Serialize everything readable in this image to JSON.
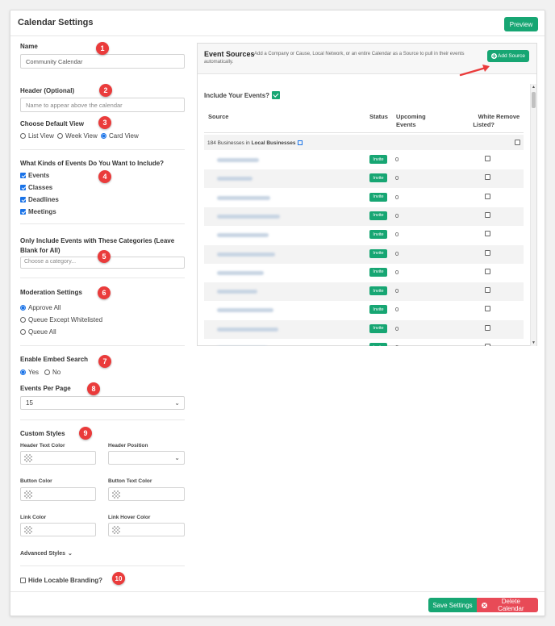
{
  "header": {
    "title": "Calendar Settings",
    "preview_label": "Preview"
  },
  "form": {
    "name": {
      "label": "Name",
      "value": "Community Calendar"
    },
    "header_opt": {
      "label": "Header (Optional)",
      "placeholder": "Name to appear above the calendar"
    },
    "default_view": {
      "label": "Choose Default View",
      "options": [
        "List View",
        "Week View",
        "Card View"
      ],
      "selected": "Card View"
    },
    "kinds": {
      "label": "What Kinds of Events Do You Want to Include?",
      "options": [
        "Events",
        "Classes",
        "Deadlines",
        "Meetings"
      ]
    },
    "categories": {
      "label": "Only Include Events with These Categories (Leave Blank for All)",
      "placeholder": "Choose a category..."
    },
    "moderation": {
      "label": "Moderation Settings",
      "options": [
        "Approve All",
        "Queue Except Whitelisted",
        "Queue All"
      ],
      "selected": "Approve All"
    },
    "embed_search": {
      "label": "Enable Embed Search",
      "options": [
        "Yes",
        "No"
      ],
      "selected": "Yes"
    },
    "per_page": {
      "label": "Events Per Page",
      "value": "15"
    },
    "custom_styles": {
      "label": "Custom Styles",
      "header_text_color": "Header Text Color",
      "header_position": "Header Position",
      "button_color": "Button Color",
      "button_text_color": "Button Text Color",
      "link_color": "Link Color",
      "link_hover_color": "Link Hover Color",
      "advanced": "Advanced Styles"
    },
    "hide_branding": "Hide Locable Branding?"
  },
  "badges": [
    "1",
    "2",
    "3",
    "4",
    "5",
    "6",
    "7",
    "8",
    "9",
    "10"
  ],
  "sources": {
    "title": "Event Sources",
    "description": "Add a Company or Cause, Local Network, or an entire Calendar as a Source to pull in their events automatically.",
    "add_label": "Add Source",
    "include_label": "Include Your Events?",
    "columns": [
      "Source",
      "Status",
      "Upcoming Events",
      "White Listed?",
      "Remove"
    ],
    "group_count": "184 Businesses in",
    "group_name": "Local Businesses",
    "invite_label": "Invite",
    "rows": [
      {
        "upcoming": "0"
      },
      {
        "upcoming": "0"
      },
      {
        "upcoming": "0"
      },
      {
        "upcoming": "0"
      },
      {
        "upcoming": "0"
      },
      {
        "upcoming": "0"
      },
      {
        "upcoming": "0"
      },
      {
        "upcoming": "0"
      },
      {
        "upcoming": "0"
      },
      {
        "upcoming": "0"
      },
      {
        "upcoming": "0"
      }
    ]
  },
  "footer": {
    "save_label": "Save Settings",
    "delete_label": "Delete Calendar"
  },
  "colors": {
    "accent_green": "#17a673",
    "danger_red": "#e84a57",
    "badge_red": "#ea3b3b"
  }
}
